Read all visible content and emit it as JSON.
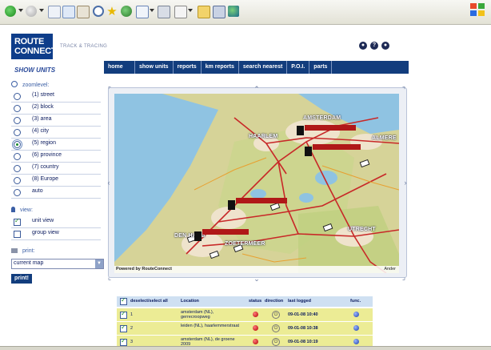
{
  "browser": {
    "toolbar_icons": [
      "back-icon",
      "forward-icon",
      "stop-icon",
      "refresh-icon",
      "home-icon",
      "search-icon",
      "favorites-icon",
      "history-icon",
      "mail-icon",
      "print-icon",
      "edit-icon",
      "folder-icon",
      "messenger-icon"
    ]
  },
  "header": {
    "logo_text_1": "ROUTE",
    "logo_text_2": "CONNECT",
    "tagline": "TRACK & TRACING"
  },
  "sidebar": {
    "title": "SHOW UNITS",
    "zoom_label": "zoomlevel:",
    "zoom_levels": [
      {
        "label": "(1) street",
        "selected": false
      },
      {
        "label": "(2) block",
        "selected": false
      },
      {
        "label": "(3) area",
        "selected": false
      },
      {
        "label": "(4) city",
        "selected": false
      },
      {
        "label": "(5) region",
        "selected": true
      },
      {
        "label": "(6) province",
        "selected": false
      },
      {
        "label": "(7) country",
        "selected": false
      },
      {
        "label": "(8) Europe",
        "selected": false
      },
      {
        "label": "auto",
        "selected": false
      }
    ],
    "view_label": "view:",
    "views": [
      {
        "label": "unit view",
        "checked": true
      },
      {
        "label": "group view",
        "checked": false
      }
    ],
    "print_label": "print:",
    "print_select_value": "current map",
    "print_button": "print!"
  },
  "nav": {
    "items": [
      "home",
      "show units",
      "reports",
      "km reports",
      "search nearest",
      "P.O.I.",
      "parts"
    ]
  },
  "map": {
    "cities": [
      "AMSTERDAM",
      "ALMERE",
      "HAARLEM",
      "DEN HAAG",
      "ZOETERMEER",
      "UTRECHT"
    ],
    "footer_left": "Powered by RouteConnect",
    "footer_right": "Ander",
    "colors": {
      "water": "#8fc3e2",
      "land": "#d9d79a",
      "urban": "#f0e6d0",
      "road": "#c82828"
    }
  },
  "table": {
    "headers": {
      "select": "deselect/select all",
      "location": "Location",
      "status": "status",
      "direction": "direction",
      "last_logged": "last logged",
      "func": "func."
    },
    "rows": [
      {
        "num": "1",
        "location": "amsterdam (NL),\ngerrecroopweg",
        "logged": "09-01-08 10:40"
      },
      {
        "num": "2",
        "location": "leiden (NL), haarlemmerstraat",
        "logged": "09-01-08 10:38"
      },
      {
        "num": "3",
        "location": "amsterdam (NL), de groene\n2009",
        "logged": "09-01-08 10:19"
      }
    ]
  }
}
